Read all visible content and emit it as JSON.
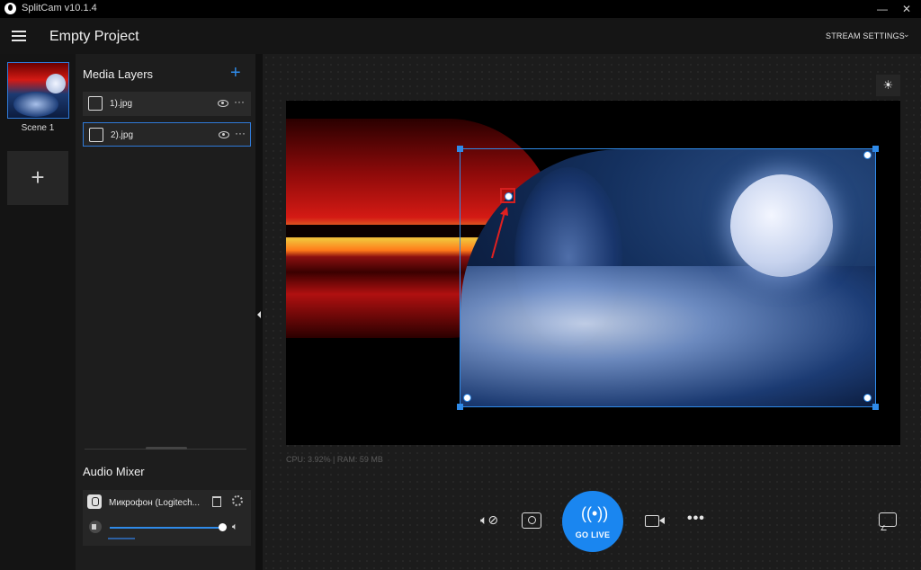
{
  "window": {
    "title": "SplitCam v10.1.4",
    "minimize": "—",
    "close": "✕"
  },
  "header": {
    "project_title": "Empty Project",
    "stream_settings_label": "STREAM SETTINGS",
    "stream_settings_chevron": "⌄"
  },
  "scenes": {
    "items": [
      {
        "label": "Scene 1",
        "selected": true
      }
    ],
    "add_label": "+"
  },
  "layers": {
    "title": "Media Layers",
    "add_label": "+",
    "items": [
      {
        "name": "1).jpg",
        "selected": false,
        "more": "···"
      },
      {
        "name": "2).jpg",
        "selected": true,
        "more": "···"
      }
    ]
  },
  "audio_mixer": {
    "title": "Audio Mixer",
    "device_name": "Микрофон  (Logitech...",
    "volume": 1.0,
    "speaker_glyph": "🔈︎"
  },
  "preview": {
    "brightness_glyph": "☀",
    "stats": "CPU: 3.92% | RAM: 59 MB"
  },
  "toolbar": {
    "mute_glyph": "🔈︎⊘",
    "go_live_label": "GO LIVE",
    "go_live_glyph": "((•))",
    "more_glyph": "•••"
  },
  "colors": {
    "accent": "#1a86f0",
    "selection": "#2f8ae8",
    "marker": "#d62020",
    "background": "#1b1b1b"
  }
}
